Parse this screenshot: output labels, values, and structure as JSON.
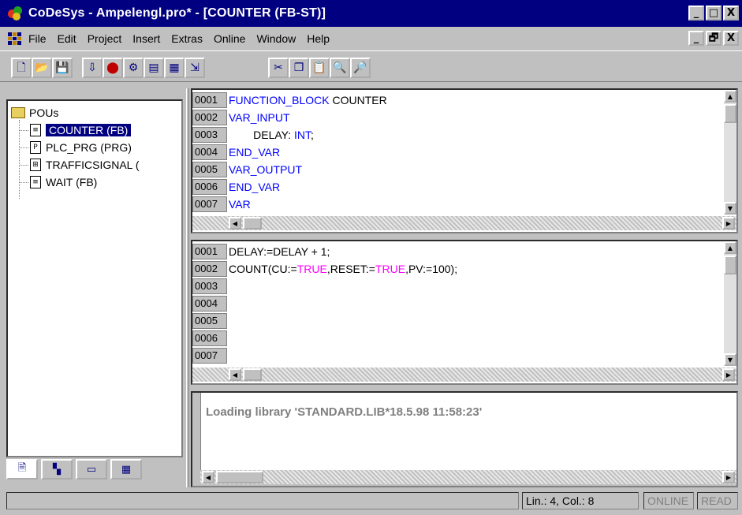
{
  "window": {
    "title": "CoDeSys - Ampelengl.pro* - [COUNTER (FB-ST)]",
    "controls": [
      "_",
      "□",
      "X"
    ]
  },
  "menubar": {
    "items": [
      "File",
      "Edit",
      "Project",
      "Insert",
      "Extras",
      "Online",
      "Window",
      "Help"
    ],
    "mdi_controls": [
      "_",
      "🗗",
      "X"
    ]
  },
  "toolbar": {
    "buttons": [
      "new-file-icon",
      "open-file-icon",
      "save-icon",
      "login-icon",
      "stop-icon",
      "run-icon",
      "build-icon",
      "rebuild-icon",
      "download-icon",
      "cut-icon",
      "copy-icon",
      "paste-icon",
      "find-icon",
      "find-next-icon"
    ]
  },
  "pou_tree": {
    "root": "POUs",
    "items": [
      {
        "label": "COUNTER (FB)",
        "selected": true
      },
      {
        "label": "PLC_PRG (PRG)",
        "selected": false
      },
      {
        "label": "TRAFFICSIGNAL (",
        "selected": false
      },
      {
        "label": "WAIT (FB)",
        "selected": false
      }
    ],
    "tabs": [
      "pous-tab",
      "data-types-tab",
      "visualizations-tab",
      "resources-tab"
    ]
  },
  "declaration_editor": {
    "lines": [
      {
        "num": "0001",
        "parts": [
          {
            "t": "FUNCTION_BLOCK",
            "c": "kw"
          },
          {
            "t": " COUNTER",
            "c": ""
          }
        ]
      },
      {
        "num": "0002",
        "parts": [
          {
            "t": "VAR_INPUT",
            "c": "kw"
          }
        ]
      },
      {
        "num": "0003",
        "parts": [
          {
            "t": "        DELAY: ",
            "c": ""
          },
          {
            "t": "INT",
            "c": "kw"
          },
          {
            "t": ";",
            "c": ""
          }
        ]
      },
      {
        "num": "0004",
        "parts": [
          {
            "t": "END_VAR",
            "c": "kw"
          }
        ]
      },
      {
        "num": "0005",
        "parts": [
          {
            "t": "VAR_OUTPUT",
            "c": "kw"
          }
        ]
      },
      {
        "num": "0006",
        "parts": [
          {
            "t": "END_VAR",
            "c": "kw"
          }
        ]
      },
      {
        "num": "0007",
        "parts": [
          {
            "t": "VAR",
            "c": "kw"
          }
        ]
      }
    ]
  },
  "body_editor": {
    "lines": [
      {
        "num": "0001",
        "parts": [
          {
            "t": "DELAY:=DELAY + 1;",
            "c": ""
          }
        ]
      },
      {
        "num": "0002",
        "parts": [
          {
            "t": "COUNT(CU:=",
            "c": ""
          },
          {
            "t": "TRUE",
            "c": "lit"
          },
          {
            "t": ",RESET:=",
            "c": ""
          },
          {
            "t": "TRUE",
            "c": "lit"
          },
          {
            "t": ",PV:=100);",
            "c": ""
          }
        ]
      },
      {
        "num": "0003",
        "parts": []
      },
      {
        "num": "0004",
        "parts": []
      },
      {
        "num": "0005",
        "parts": []
      },
      {
        "num": "0006",
        "parts": []
      },
      {
        "num": "0007",
        "parts": []
      }
    ]
  },
  "messages": {
    "text": "Loading library 'STANDARD.LIB*18.5.98 11:58:23'"
  },
  "statusbar": {
    "position": "Lin.: 4, Col.: 8",
    "online": "ONLINE",
    "read": "READ"
  }
}
